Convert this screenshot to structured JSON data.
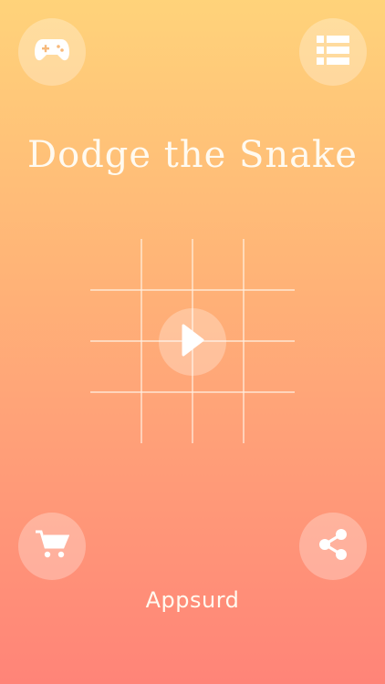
{
  "app": {
    "title": "Dodge the Snake",
    "brand": "Appsurd"
  },
  "icons": {
    "top_left": "gamepad-icon",
    "top_right": "list-icon",
    "bottom_left": "cart-icon",
    "bottom_right": "share-icon",
    "center": "play-icon"
  },
  "colors": {
    "gradient_top": "#ffd37a",
    "gradient_bottom": "#ff8478",
    "foreground": "#fffaf0"
  }
}
